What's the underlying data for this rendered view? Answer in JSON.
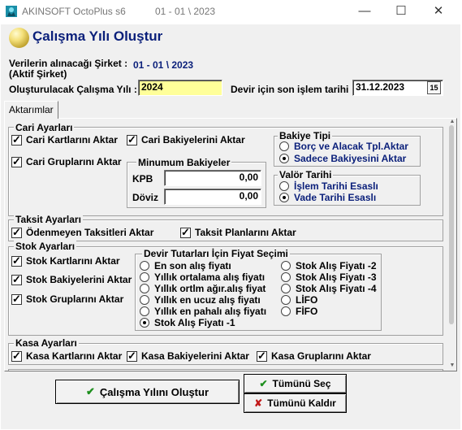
{
  "window": {
    "app_title": "AKINSOFT OctoPlus s6",
    "subtitle": "01 - 01 \\ 2023",
    "minimize": "—",
    "maximize": "☐",
    "close": "✕"
  },
  "header": {
    "title": "Çalışma Yılı Oluştur"
  },
  "form": {
    "source_company_label": "Verilerin alınacağı Şirket :",
    "source_company_value": "01 - 01 \\ 2023",
    "active_company_label": "(Aktif Şirket)",
    "year_label": "Oluşturulacak Çalışma Yılı :",
    "year_value": "2024",
    "last_date_label": "Devir için son işlem tarihi",
    "last_date_value": "31.12.2023",
    "calendar_button": "15"
  },
  "tabs": [
    {
      "label": "Aktarımlar"
    }
  ],
  "cari": {
    "title": "Cari Ayarları",
    "kart": "Cari Kartlarını Aktar",
    "bakiye": "Cari Bakiyelerini Aktar",
    "grup": "Cari Gruplarını Aktar",
    "min_title": "Minumum Bakiyeler",
    "kpb_label": "KPB",
    "kpb_value": "0,00",
    "doviz_label": "Döviz",
    "doviz_value": "0,00",
    "bakiye_tipi_title": "Bakiye Tipi",
    "bt_opt1": "Borç ve Alacak Tpl.Aktar",
    "bt_opt2": "Sadece Bakiyesini Aktar",
    "valor_title": "Valör Tarihi",
    "vt_opt1": "İşlem Tarihi Esaslı",
    "vt_opt2": "Vade Tarihi Esaslı"
  },
  "taksit": {
    "title": "Taksit Ayarları",
    "odenmeyen": "Ödenmeyen Taksitleri Aktar",
    "plan": "Taksit Planlarını Aktar"
  },
  "stok": {
    "title": "Stok Ayarları",
    "kart": "Stok Kartlarını Aktar",
    "bakiye": "Stok Bakiyelerini Aktar",
    "grup": "Stok Gruplarını Aktar",
    "fiyat_title": "Devir Tutarları İçin Fiyat Seçimi",
    "f1": "En son alış fiyatı",
    "f2": "Yıllık ortalama alış fiyatı",
    "f3": "Yıllık ortlm ağır.alış fiyat",
    "f4": "Yıllık en ucuz alış fiyatı",
    "f5": "Yıllık en pahalı alış fiyatı",
    "f6": "Stok Alış Fiyatı -1",
    "f7": "Stok Alış Fiyatı -2",
    "f8": "Stok Alış Fiyatı -3",
    "f9": "Stok Alış Fiyatı -4",
    "f10": "LİFO",
    "f11": "FİFO"
  },
  "kasa": {
    "title": "Kasa Ayarları",
    "kart": "Kasa Kartlarını Aktar",
    "bakiye": "Kasa Bakiyelerini Aktar",
    "grup": "Kasa Gruplarını Aktar"
  },
  "buttons": {
    "create": "Çalışma Yılını Oluştur",
    "select_all": "Tümünü Seç",
    "clear_all": "Tümünü Kaldır"
  },
  "colors": {
    "accent": "#0a1f7a",
    "year_field": "#ffff99",
    "check_green": "#1e8f1e",
    "cross_red": "#c21a1a"
  }
}
